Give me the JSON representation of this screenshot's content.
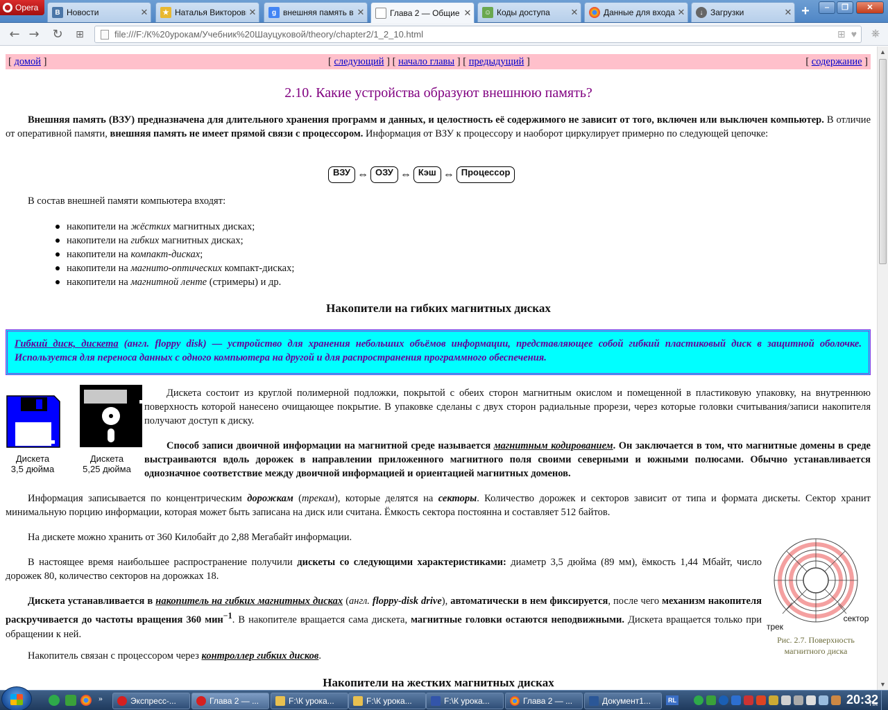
{
  "browser": {
    "opera_label": "Opera",
    "tabs": [
      {
        "title": "Новости",
        "icon": "vk-icon"
      },
      {
        "title": "Наталья Викторовна",
        "icon": "star-icon"
      },
      {
        "title": "внешняя память в",
        "icon": "google-icon"
      },
      {
        "title": "Глава 2 — Общие",
        "icon": "page-icon"
      },
      {
        "title": "Коды доступа",
        "icon": "people-icon"
      },
      {
        "title": "Данные для входа",
        "icon": "chrome-icon"
      },
      {
        "title": "Загрузки",
        "icon": "download-icon"
      }
    ],
    "url": "file:///F:/К%20урокам/Учебник%20Шауцуковой/theory/chapter2/1_2_10.html"
  },
  "nav": {
    "home": "домой",
    "next": "следующий",
    "chapter_start": "начало главы",
    "prev": "предыдущий",
    "contents": "содержание"
  },
  "content": {
    "title": "2.10. Какие устройства образуют внешнюю память?",
    "p1_b1": "Внешняя память (ВЗУ) предназначена для длительного хранения программ и данных, и целостность её содержимого не зависит от того, включен или выключен компьютер.",
    "p1_t1": " В отличие от оперативной памяти, ",
    "p1_b2": "внешняя память не имеет прямой связи с процессором.",
    "p1_t2": " Информация от ВЗУ к процессору и наоборот циркулирует примерно по следующей цепочке:",
    "chain": [
      "ВЗУ",
      "ОЗУ",
      "Кэш",
      "Процессор"
    ],
    "list_intro": "В состав внешней памяти компьютера входят:",
    "list": [
      {
        "pre": "накопители на ",
        "em": "жёстких",
        "post": " магнитных дисках;"
      },
      {
        "pre": "накопители на ",
        "em": "гибких",
        "post": " магнитных дисках;"
      },
      {
        "pre": "накопители на ",
        "em": "компакт-дисках",
        "post": ";"
      },
      {
        "pre": "накопители на ",
        "em": "магнито-оптических",
        "post": " компакт-дисках;"
      },
      {
        "pre": "накопители на ",
        "em": "магнитной ленте",
        "post": " (стримеры) и др."
      }
    ],
    "h_floppy": "Накопители на гибких магнитных дисках",
    "def_term": "Гибкий диск, дискета",
    "def_open": " (",
    "def_lang": "англ. floppy disk",
    "def_rest": ") — устройство для хранения небольших объёмов информации, представляющее собой гибкий пластиковый диск в защитной оболочке. Используется для переноса данных с одного компьютера на другой и для распространения программного обеспечения.",
    "fig1_cap1": "Дискета\n3,5 дюйма",
    "fig1_cap2": "Дискета\n5,25 дюйма",
    "p2": "Дискета состоит из круглой полимерной подложки, покрытой с обеих сторон магнитным окислом и помещенной в пластиковую упаковку, на внутреннюю поверхность которой нанесено очищающее покрытие. В упаковке сделаны с двух сторон радиальные прорези, через которые головки считывания/записи накопителя получают доступ к диску.",
    "p3_b1": "Способ записи двоичной информации на магнитной среде называется ",
    "p3_term": "магнитным кодированием",
    "p3_b2": ". Он заключается в том, что магнитные домены в среде выстраиваются вдоль дорожек в направлении приложенного магнитного поля своими северными и южными полюсами. Обычно устанавливается однозначное соответствие между двоичной информацией и ориентацией магнитных доменов.",
    "p4_t1": "Информация записывается по концентрическим ",
    "p4_e1": "дорожкам",
    "p4_t2": " (",
    "p4_e2": "трекам",
    "p4_t3": "), которые делятся на ",
    "p4_e3": "секторы",
    "p4_t4": ". Количество дорожек и секторов зависит от типа и формата дискеты. Сектор хранит минимальную порцию информации, которая может быть записана на диск или считана. Ёмкость сектора постоянна и составляет 512 байтов.",
    "p5": "На дискете можно хранить от 360 Килобайт до 2,88 Мегабайт информации.",
    "p6_t1": "В настоящее время наибольшее распространение получили ",
    "p6_b1": "дискеты со следующими характеристиками:",
    "p6_t2": " диаметр 3,5 дюйма (89 мм), ёмкость 1,44 Мбайт, число дорожек 80, количество секторов на дорожках 18.",
    "p7_b1": "Дискета устанавливается в ",
    "p7_term": "накопитель на гибких магнитных дисках",
    "p7_t1": " (",
    "p7_lang": "англ.",
    "p7_b2": " floppy-disk drive",
    "p7_t2": "), ",
    "p7_b3": "автоматически в нем фиксируется",
    "p7_t3": ", после чего ",
    "p7_b4": "механизм накопителя раскручивается до частоты вращения 360 мин",
    "p7_sup": "−1",
    "p7_t4": ". В накопителе вращается сама дискета, ",
    "p7_b5": "магнитные головки остаются неподвижными.",
    "p7_t5": " Дискета вращается только при обращении к ней.",
    "p8_t1": "Накопитель связан с процессором через ",
    "p8_term": "контроллер гибких дисков",
    "p8_t2": ".",
    "fig2_track": "трек",
    "fig2_sector": "сектор",
    "fig2_caption": "Рис. 2.7. Поверхность магнитного диска",
    "h_hard": "Накопители на жестких магнитных дисках"
  },
  "taskbar": {
    "tasks": [
      {
        "title": "Экспресс-...",
        "icon": "opera-icon"
      },
      {
        "title": "Глава 2 — ...",
        "icon": "opera-icon"
      },
      {
        "title": "F:\\К урока...",
        "icon": "folder-icon"
      },
      {
        "title": "F:\\К урока...",
        "icon": "folder-icon"
      },
      {
        "title": "F:\\К урока...",
        "icon": "window-icon"
      },
      {
        "title": "Глава 2 — ...",
        "icon": "chrome-icon"
      },
      {
        "title": "Документ1...",
        "icon": "word-icon"
      }
    ],
    "lang": "RL",
    "time": "20:32",
    "day": "Пн"
  },
  "colors": {
    "nav_bg": "#ffc0cb",
    "title": "#800080",
    "def_bg": "#00ffff",
    "def_text": "#660099",
    "link": "#0000cc"
  }
}
